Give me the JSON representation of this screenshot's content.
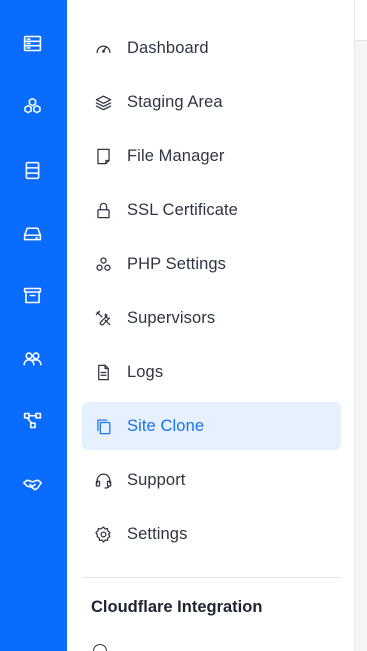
{
  "rail": {
    "items": [
      {
        "icon": "server-icon"
      },
      {
        "icon": "apps-icon"
      },
      {
        "icon": "database-icon"
      },
      {
        "icon": "drive-icon"
      },
      {
        "icon": "archive-icon"
      },
      {
        "icon": "users-icon"
      },
      {
        "icon": "network-icon"
      },
      {
        "icon": "handshake-icon"
      }
    ]
  },
  "sidebar": {
    "items": [
      {
        "label": "Dashboard",
        "icon": "gauge-icon"
      },
      {
        "label": "Staging Area",
        "icon": "layers-icon"
      },
      {
        "label": "File Manager",
        "icon": "file-icon"
      },
      {
        "label": "SSL Certificate",
        "icon": "lock-icon"
      },
      {
        "label": "PHP Settings",
        "icon": "cubes-icon"
      },
      {
        "label": "Supervisors",
        "icon": "tools-icon"
      },
      {
        "label": "Logs",
        "icon": "document-icon"
      },
      {
        "label": "Site Clone",
        "icon": "copy-icon",
        "active": true
      },
      {
        "label": "Support",
        "icon": "headset-icon"
      },
      {
        "label": "Settings",
        "icon": "gear-icon"
      }
    ],
    "section_title": "Cloudflare Integration"
  },
  "colors": {
    "rail_bg": "#0a6cff",
    "active_bg": "#e6f0ff",
    "active_text": "#1a73e8",
    "text": "#2f3542"
  }
}
